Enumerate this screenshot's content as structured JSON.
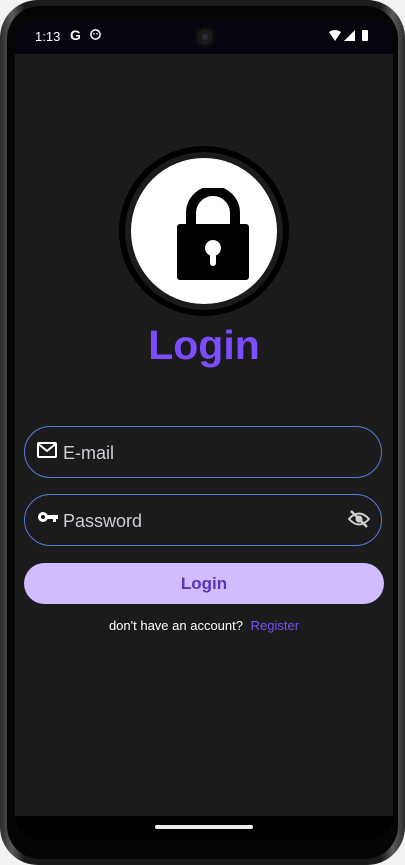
{
  "status_bar": {
    "time": "1:13",
    "google_glyph": "G",
    "icons": [
      "google-icon",
      "face-icon",
      "wifi-icon",
      "signal-icon",
      "battery-icon"
    ]
  },
  "login": {
    "logo_icon": "lock-icon",
    "title": "Login",
    "email": {
      "placeholder": "E-mail",
      "value": "",
      "icon": "mail-icon"
    },
    "password": {
      "placeholder": "Password",
      "value": "",
      "icon": "key-icon",
      "toggle_icon": "eye-off-icon"
    },
    "submit_label": "Login",
    "register_prompt": "don't have an account?",
    "register_link": "Register"
  },
  "colors": {
    "accent": "#7c4dff",
    "button_bg": "#d0bcff",
    "field_border": "#4f7fd6",
    "background": "#1c1b1c"
  }
}
